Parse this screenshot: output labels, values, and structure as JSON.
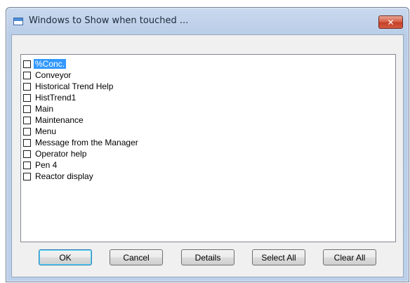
{
  "window": {
    "title": "Windows to Show when touched ...",
    "close_glyph": "✕"
  },
  "list": {
    "items": [
      {
        "label": "%Conc.",
        "checked": false,
        "selected": true
      },
      {
        "label": "Conveyor",
        "checked": false,
        "selected": false
      },
      {
        "label": "Historical Trend Help",
        "checked": false,
        "selected": false
      },
      {
        "label": "HistTrend1",
        "checked": false,
        "selected": false
      },
      {
        "label": "Main",
        "checked": false,
        "selected": false
      },
      {
        "label": "Maintenance",
        "checked": false,
        "selected": false
      },
      {
        "label": "Menu",
        "checked": false,
        "selected": false
      },
      {
        "label": "Message from the Manager",
        "checked": false,
        "selected": false
      },
      {
        "label": "Operator help",
        "checked": false,
        "selected": false
      },
      {
        "label": "Pen 4",
        "checked": false,
        "selected": false
      },
      {
        "label": "Reactor display",
        "checked": false,
        "selected": false
      }
    ]
  },
  "buttons": {
    "ok": "OK",
    "cancel": "Cancel",
    "details": "Details",
    "select_all": "Select All",
    "clear_all": "Clear All"
  },
  "colors": {
    "selection": "#3399ff",
    "close_button": "#c4402a"
  }
}
